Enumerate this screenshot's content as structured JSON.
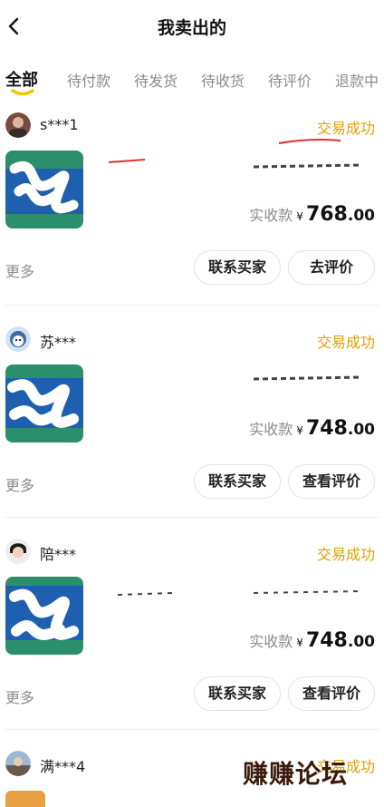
{
  "header": {
    "title": "我卖出的",
    "back_icon": "chevron-left-icon"
  },
  "tabs": [
    "全部",
    "待付款",
    "待发货",
    "待收货",
    "待评价",
    "退款中"
  ],
  "accent_color": "#f5c300",
  "status_color": "#e0a000",
  "orders": [
    {
      "buyer": "s***1",
      "status": "交易成功",
      "price_label": "实收款",
      "currency": "¥",
      "price_int": "768",
      "price_dec": ".00",
      "more": "更多",
      "contact": "联系买家",
      "review": "去评价"
    },
    {
      "buyer": "苏***",
      "status": "交易成功",
      "price_label": "实收款",
      "currency": "¥",
      "price_int": "748",
      "price_dec": ".00",
      "more": "更多",
      "contact": "联系买家",
      "review": "查看评价"
    },
    {
      "buyer": "陪***",
      "status": "交易成功",
      "price_label": "实收款",
      "currency": "¥",
      "price_int": "748",
      "price_dec": ".00",
      "more": "更多",
      "contact": "联系买家",
      "review": "查看评价"
    },
    {
      "buyer": "满***4",
      "status": "交易成功"
    }
  ],
  "watermark": "赚赚论坛"
}
